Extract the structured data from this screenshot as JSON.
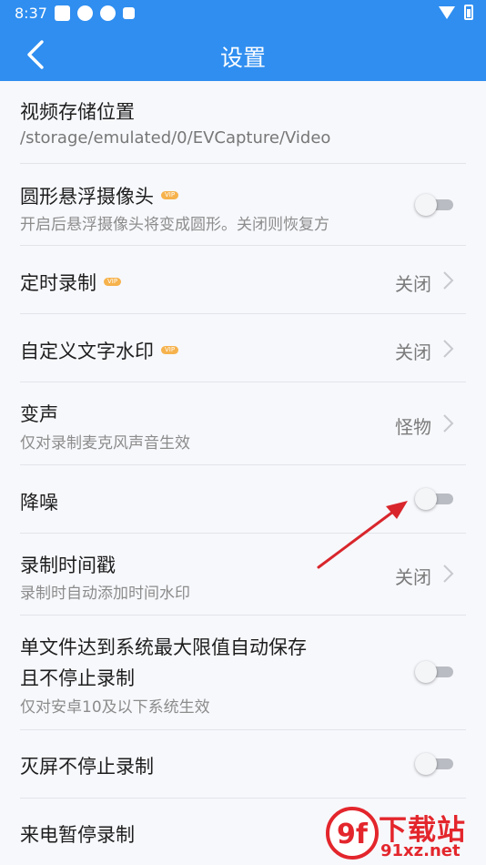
{
  "status": {
    "time": "8:37"
  },
  "header": {
    "title": "设置"
  },
  "settings": {
    "storage": {
      "title": "视频存储位置",
      "path": "/storage/emulated/0/EVCapture/Video"
    },
    "round_camera": {
      "title": "圆形悬浮摄像头",
      "badge": "VIP",
      "subtitle": "开启后悬浮摄像头将变成圆形。关闭则恢复方",
      "enabled": false
    },
    "timed_record": {
      "title": "定时录制",
      "badge": "VIP",
      "value": "关闭"
    },
    "text_watermark": {
      "title": "自定义文字水印",
      "badge": "VIP",
      "value": "关闭"
    },
    "voice_change": {
      "title": "变声",
      "subtitle": "仅对录制麦克风声音生效",
      "value": "怪物"
    },
    "noise_reduction": {
      "title": "降噪",
      "enabled": false
    },
    "timestamp": {
      "title": "录制时间戳",
      "subtitle": "录制时自动添加时间水印",
      "value": "关闭"
    },
    "auto_save": {
      "title_line1": "单文件达到系统最大限值自动保存",
      "title_line2": "且不停止录制",
      "subtitle": "仅对安卓10及以下系统生效",
      "enabled": false
    },
    "screen_off": {
      "title": "灭屏不停止录制",
      "enabled": false
    },
    "call_pause": {
      "title": "来电暂停录制"
    }
  },
  "watermark": {
    "logo_text": "9f",
    "text_top": "下载站",
    "text_bottom": "91xz.net"
  },
  "colors": {
    "accent": "#2f8ef0",
    "vip": "#f6b24c",
    "annotation_arrow": "#d8262c"
  }
}
